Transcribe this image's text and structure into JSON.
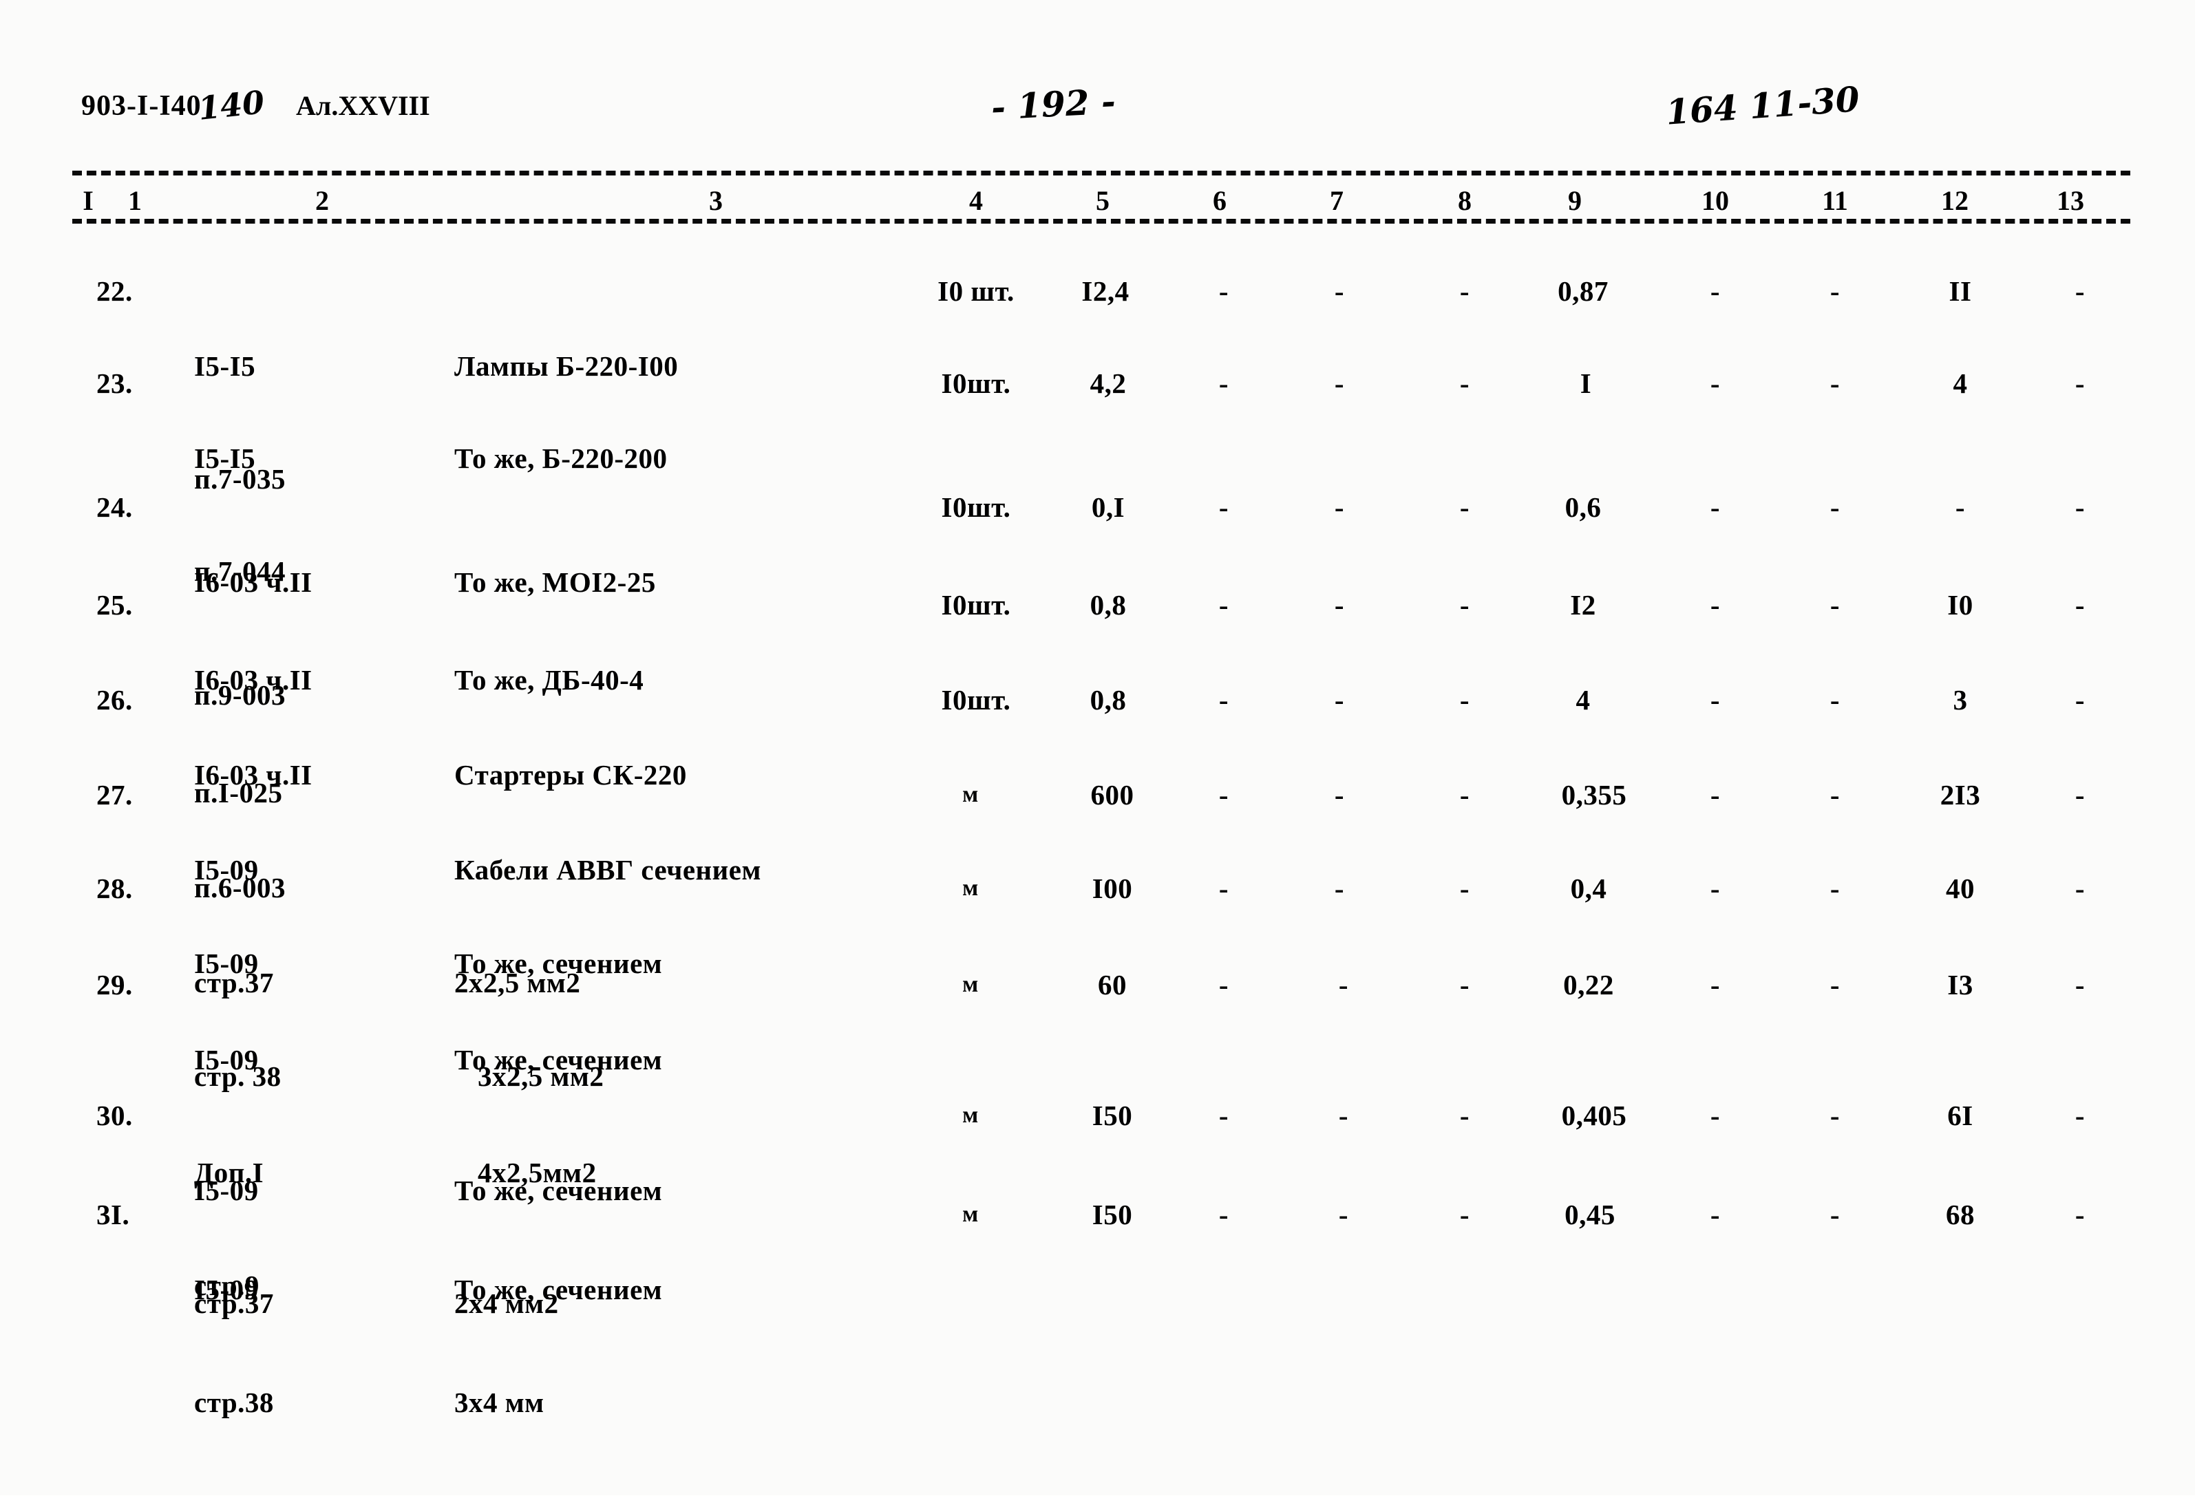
{
  "document": {
    "series_code": "903-I-I40",
    "series_code_handwritten": "140",
    "album": "Ал.XXVIII",
    "page_number": "- 192 -",
    "stamp_right": "164 11-30"
  },
  "table": {
    "column_numbers": [
      "I",
      "1",
      "2",
      "3",
      "4",
      "5",
      "6",
      "7",
      "8",
      "9",
      "10",
      "11",
      "12",
      "13"
    ],
    "rows": [
      {
        "no": "22.",
        "ref_line1": "I5-I5",
        "ref_line2": "п.7-035",
        "name_line1": "Лампы Б-220-I00",
        "name_line2": "",
        "unit": "I0 шт.",
        "c5": "I2,4",
        "c6": "-",
        "c7": "-",
        "c8": "-",
        "c9": "0,87",
        "c10": "-",
        "c11": "-",
        "c12": "II",
        "c13": "-"
      },
      {
        "no": "23.",
        "ref_line1": "I5-I5",
        "ref_line2": "п.7-044",
        "name_line1": "То же, Б-220-200",
        "name_line2": "",
        "unit": "I0шт.",
        "c5": "4,2",
        "c6": "-",
        "c7": "-",
        "c8": "-",
        "c9": "I",
        "c10": "-",
        "c11": "-",
        "c12": "4",
        "c13": "-"
      },
      {
        "no": "24.",
        "ref_line1": "I6-03 ч.II",
        "ref_line2": "п.9-003",
        "name_line1": "То же, МОI2-25",
        "name_line2": "",
        "unit": "I0шт.",
        "c5": "0,I",
        "c6": "-",
        "c7": "-",
        "c8": "-",
        "c9": "0,6",
        "c10": "-",
        "c11": "-",
        "c12": "-",
        "c13": "-"
      },
      {
        "no": "25.",
        "ref_line1": "I6-03 ч.II",
        "ref_line2": "п.I-025",
        "name_line1": "То же, ДБ-40-4",
        "name_line2": "",
        "unit": "I0шт.",
        "c5": "0,8",
        "c6": "-",
        "c7": "-",
        "c8": "-",
        "c9": "I2",
        "c10": "-",
        "c11": "-",
        "c12": "I0",
        "c13": "-"
      },
      {
        "no": "26.",
        "ref_line1": "I6-03 ч.II",
        "ref_line2": "п.6-003",
        "name_line1": "Стартеры СК-220",
        "name_line2": "",
        "unit": "I0шт.",
        "c5": "0,8",
        "c6": "-",
        "c7": "-",
        "c8": "-",
        "c9": "4",
        "c10": "-",
        "c11": "-",
        "c12": "3",
        "c13": "-"
      },
      {
        "no": "27.",
        "ref_line1": "I5-09",
        "ref_line2": "стр.37",
        "name_line1": "Кабели АВВГ сечением",
        "name_line2": "2х2,5 мм2",
        "unit": "м",
        "c5": "600",
        "c6": "-",
        "c7": "-",
        "c8": "-",
        "c9": "0,355",
        "c10": "-",
        "c11": "-",
        "c12": "2I3",
        "c13": "-"
      },
      {
        "no": "28.",
        "ref_line1": "I5-09",
        "ref_line2": "стр. 38",
        "name_line1": "То же, сечением",
        "name_line2": "3х2,5 мм2",
        "unit": "м",
        "c5": "I00",
        "c6": "-",
        "c7": "-",
        "c8": "-",
        "c9": "0,4",
        "c10": "-",
        "c11": "-",
        "c12": "40",
        "c13": "-"
      },
      {
        "no": "29.",
        "ref_line1": "I5-09",
        "ref_line2": "Доп.I",
        "ref_line3": "стр.9",
        "name_line1": "То же, сечением",
        "name_line2": "4х2,5мм2",
        "unit": "м",
        "c5": "60",
        "c6": "-",
        "c7": "-",
        "c8": "-",
        "c9": "0,22",
        "c10": "-",
        "c11": "-",
        "c12": "I3",
        "c13": "-"
      },
      {
        "no": "30.",
        "ref_line1": "I5-09",
        "ref_line2": "стр.37",
        "name_line1": "То же, сечением",
        "name_line2": "2х4 мм2",
        "unit": "м",
        "c5": "I50",
        "c6": "-",
        "c7": "-",
        "c8": "-",
        "c9": "0,405",
        "c10": "-",
        "c11": "-",
        "c12": "6I",
        "c13": "-"
      },
      {
        "no": "3I.",
        "ref_line1": "I5-09",
        "ref_line2": "стр.38",
        "name_line1": "То же, сечением",
        "name_line2": "3х4 мм",
        "unit": "м",
        "c5": "I50",
        "c6": "-",
        "c7": "-",
        "c8": "-",
        "c9": "0,45",
        "c10": "-",
        "c11": "-",
        "c12": "68",
        "c13": "-"
      }
    ]
  }
}
